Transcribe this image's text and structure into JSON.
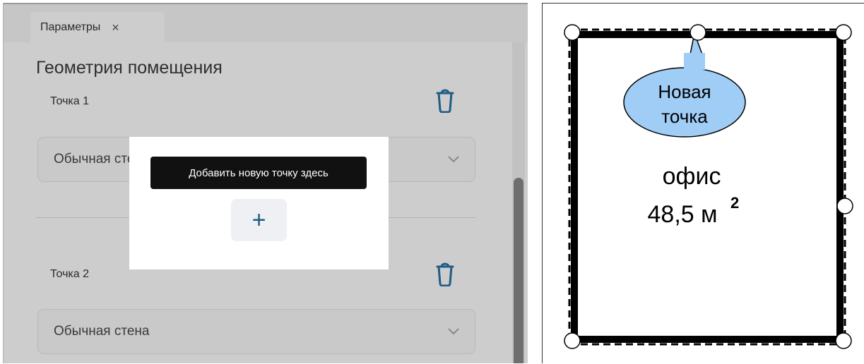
{
  "panel": {
    "tab_label": "Параметры",
    "tab_close": "×",
    "section_title": "Геометрия помещения",
    "points": [
      {
        "label": "Точка 1",
        "wall_type": "Обычная стена"
      },
      {
        "label": "Точка 2",
        "wall_type": "Обычная стена"
      }
    ],
    "tooltip": "Добавить новую точку здесь",
    "add_button_symbol": "+"
  },
  "plan": {
    "callout_line1": "Новая",
    "callout_line2": "точка",
    "room_name": "офис",
    "room_area": "48,5 м",
    "room_area_sup": "2"
  },
  "colors": {
    "accent": "#1f5c86",
    "callout_fill": "#9fcdf5"
  }
}
